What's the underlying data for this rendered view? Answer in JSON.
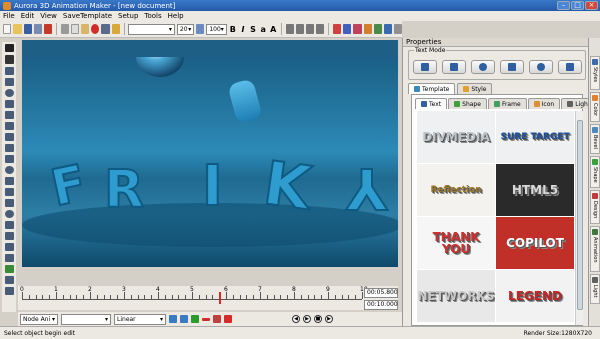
{
  "window": {
    "title": "Aurora 3D Animation Maker - [new document]"
  },
  "menu": [
    "File",
    "Edit",
    "View",
    "SaveTemplate",
    "Setup",
    "Tools",
    "Help"
  ],
  "toolbar": {
    "font_value": "",
    "size_value": "20",
    "zoom_value": "100",
    "bold": "B",
    "italic": "I",
    "strike": "S",
    "small_a": "a",
    "big_a": "A",
    "template_label": "Template",
    "style_label": "Style"
  },
  "canvas": {
    "letters": [
      "F",
      "R",
      "I",
      "K",
      "Y",
      "Z"
    ]
  },
  "timeline": {
    "ticks": [
      "0",
      "1",
      "2",
      "3",
      "4",
      "5",
      "6",
      "7",
      "8",
      "9",
      "10"
    ],
    "current_time": "00:05.800",
    "total_time": "00:10.000",
    "playhead_fraction": 0.58
  },
  "anim_bar": {
    "node_label": "Node Ani",
    "ease_value": "Linear"
  },
  "status": {
    "left": "Select object begin edit",
    "right": "Render Size:1280X720"
  },
  "properties": {
    "title": "Properties",
    "text_mode_label": "Text Mode",
    "tabs": [
      "Template",
      "Style"
    ],
    "subtabs": [
      "Text",
      "Shape",
      "Frame",
      "Icon",
      "Light"
    ],
    "thumbs": [
      {
        "text": "DIVMEDIA",
        "color": "#bfc4c9",
        "bg": "#eef0f2"
      },
      {
        "text": "SURE TARGET",
        "color": "#1c4f9c",
        "bg": "#eef0f2"
      },
      {
        "text": "Reflection",
        "color": "#9a7a2a",
        "bg": "#f4f2ee"
      },
      {
        "text": "HTML5",
        "color": "#d8d8d8",
        "bg": "#2a2a2a"
      },
      {
        "text": "THANK YOU",
        "color": "#d23030",
        "bg": "#f6f6f6"
      },
      {
        "text": "COPILOT",
        "color": "#ffffff",
        "bg": "#c03028"
      },
      {
        "text": "NETWORKS",
        "color": "#c9c9c9",
        "bg": "#e8e8e8"
      },
      {
        "text": "LEGEND",
        "color": "#c42626",
        "bg": "#f2f2f2"
      }
    ]
  },
  "side_tabs": [
    "Styles",
    "Color",
    "Bevel",
    "Shape",
    "Design",
    "Animation",
    "Light"
  ]
}
